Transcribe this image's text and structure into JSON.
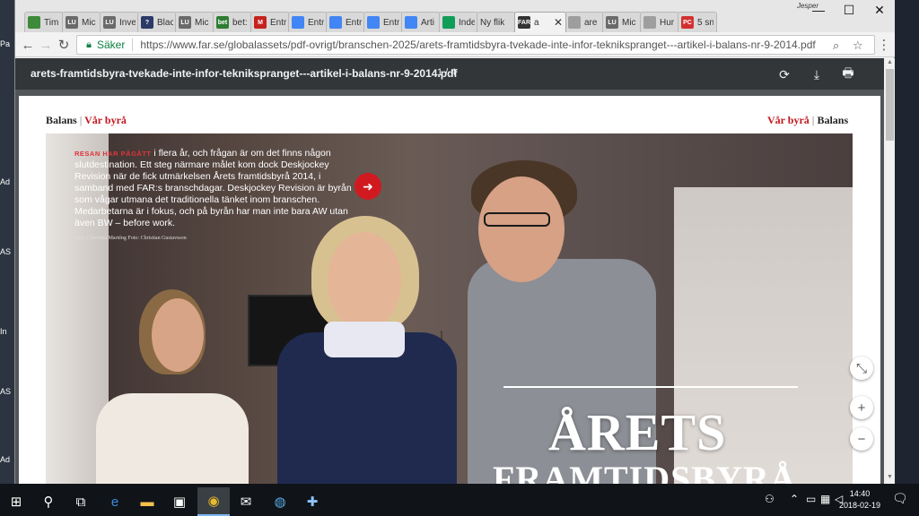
{
  "desktop": {
    "fragments": [
      "Pa",
      "Ad",
      "AS",
      "In",
      "AS",
      "Ad"
    ]
  },
  "browser": {
    "user_name": "Jesper",
    "tabs": [
      {
        "title": "Tim",
        "icon": "leaf-icon",
        "color": "#3d8a3a"
      },
      {
        "title": "Mic",
        "icon": "lu-icon",
        "color": "#6a6a6a",
        "label": "LU"
      },
      {
        "title": "Inve",
        "icon": "lu-icon",
        "color": "#6a6a6a",
        "label": "LU"
      },
      {
        "title": "Blac",
        "icon": "question-icon",
        "color": "#2b3a67",
        "label": "?"
      },
      {
        "title": "Mic",
        "icon": "lu-icon",
        "color": "#6a6a6a",
        "label": "LU"
      },
      {
        "title": "bet:",
        "icon": "sheet-icon",
        "color": "#2e7d32",
        "label": "bet"
      },
      {
        "title": "Entr",
        "icon": "gmail-icon",
        "color": "#c5221f",
        "label": "M"
      },
      {
        "title": "Entr",
        "icon": "drive-icon",
        "color": "#4285f4"
      },
      {
        "title": "Entr",
        "icon": "drive-icon",
        "color": "#4285f4"
      },
      {
        "title": "Entr",
        "icon": "drive-icon",
        "color": "#4285f4"
      },
      {
        "title": "Arti",
        "icon": "docs-icon",
        "color": "#4285f4"
      },
      {
        "title": "Inde",
        "icon": "sheets-icon",
        "color": "#0f9d58"
      },
      {
        "title": "Ny flik",
        "icon": "none",
        "color": "transparent"
      },
      {
        "title": "a",
        "icon": "far-icon",
        "color": "#333333",
        "label": "FAR",
        "active": true
      },
      {
        "title": "are",
        "icon": "doc-icon",
        "color": "#9e9e9e"
      },
      {
        "title": "Mic",
        "icon": "lu-icon",
        "color": "#6a6a6a",
        "label": "LU"
      },
      {
        "title": "Hur",
        "icon": "doc-icon",
        "color": "#9e9e9e"
      },
      {
        "title": "5 sn",
        "icon": "pc-icon",
        "color": "#d32f2f",
        "label": "PC"
      }
    ],
    "secure_label": "Säker",
    "url": "https://www.far.se/globalassets/pdf-ovrigt/branschen-2025/arets-framtidsbyra-tvekade-inte-infor-teknikspranget---artikel-i-balans-nr-9-2014.pdf"
  },
  "pdf": {
    "filename": "arets-framtidsbyra-tvekade-inte-infor-teknikspranget---artikel-i-balans-nr-9-2014.pdf",
    "pages": "1 / 4",
    "header_left": {
      "magazine": "Balans",
      "section": "Vår byrå"
    },
    "header_right": {
      "section": "Vår byrå",
      "magazine": "Balans"
    },
    "caption_lead": "RESAN HAR PÅGÅTT",
    "caption_body": " i flera år, och frågan är om det finns någon slutdestination. Ett steg närmare målet kom dock Deskjockey Revision när de fick utmärkelsen Årets framtidsbyrå 2014, i samband med FAR:s branschdagar. Deskjockey Revision är byrån som vågar utmana det traditionella tänket inom branschen. Medarbetarna är i fokus, och på byrån har man inte bara AW utan även BW – before work.",
    "credit": "Text: Charlotta Marténg  Foto: Christian Gustavsson",
    "headline_line1": "ÅRETS",
    "headline_line2": "FRAMTIDSBYRÅ",
    "accent_red": "#c3161c"
  },
  "taskbar": {
    "time": "14:40",
    "date": "2018-02-19"
  }
}
